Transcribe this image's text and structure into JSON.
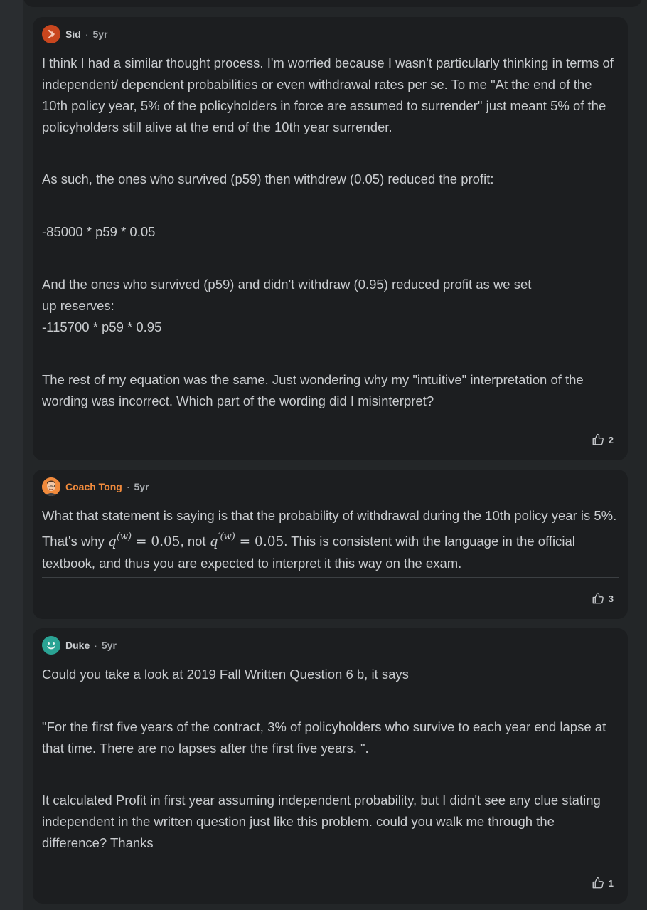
{
  "comments": [
    {
      "author": "Sid",
      "separator": "·",
      "age": "5yr",
      "paragraphs": [
        "I think I had a similar thought process. I'm worried because I wasn't particularly thinking in terms of independent/ dependent probabilities or even withdrawal rates per se. To me \"At the end of the 10th policy year, 5% of the policyholders in force are assumed to surrender\" just meant 5% of the policyholders still alive at the end of the 10th year surrender.",
        "As such, the ones who survived (p59) then withdrew (0.05) reduced the profit:",
        "-85000 * p59 * 0.05",
        "And the ones who survived (p59) and didn't withdraw (0.95) reduced profit as we set\nup reserves:\n-115700 * p59 * 0.95",
        "The rest of my equation was the same. Just wondering why my \"intuitive\" interpretation of the wording was incorrect. Which part of the wording did I misinterpret?"
      ],
      "likes": "2"
    },
    {
      "author": "Coach Tong",
      "separator": "·",
      "age": "5yr",
      "text_before": "What that statement is saying is that the probability of withdrawal during the 10th policy year is 5%. That's why ",
      "math1_base": "q",
      "math1_sup": "(w)",
      "math1_rest": " = 0.05",
      "text_middle": ", not ",
      "math2_base": "q",
      "math2_sup": "′(w)",
      "math2_rest": " = 0.05",
      "text_after": ". This is consistent with the language in the official textbook, and thus you are expected to interpret it this way on the exam.",
      "likes": "3"
    },
    {
      "author": "Duke",
      "separator": "·",
      "age": "5yr",
      "paragraphs": [
        "Could you take a look at 2019 Fall Written Question 6 b, it says",
        "\"For the first five years of the contract, 3% of policyholders who survive to each year end lapse at that time. There are no lapses after the first five years. \".",
        "It calculated Profit in first year assuming independent probability, but I didn't see any clue stating independent in the written question just like this problem. could you walk me through the difference? Thanks"
      ],
      "likes": "1"
    }
  ],
  "colors": {
    "background": "#232628",
    "card": "#1c1e20",
    "text": "#c9cccf",
    "coach_accent": "#f08a3c",
    "sid_avatar": "#c8461e",
    "duke_avatar": "#2aa394"
  },
  "icons": {
    "sid_avatar": "chevron-right-icon",
    "coach_avatar": "person-photo-icon",
    "duke_avatar": "smiley-icon",
    "like": "thumbs-up-icon"
  }
}
